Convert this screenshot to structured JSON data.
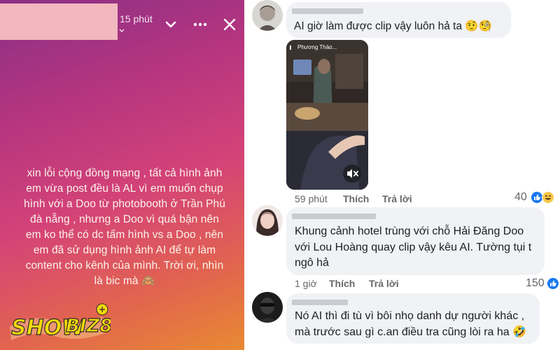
{
  "story": {
    "time": "15 phút",
    "text": "xin lỗi cộng đồng mạng , tất cả hình ảnh em vừa post đều là AL vì em muốn chụp hình với a Doo từ photobooth ở Trần Phú đà nẵng , nhưng a Doo vì quá bận nên em ko thể có dc tấm hình vs a Doo , nên em đã sử dụng hình ảnh AI để tự làm content cho kênh của mình. Trời ơi, nhìn là bic mà 🙈",
    "logo": "SHOWBIZ8",
    "icons": [
      "chevron-down-icon",
      "more-icon",
      "close-icon"
    ]
  },
  "comments": [
    {
      "text": "AI giờ làm được clip vậy luôn hả ta 🤨🧐",
      "video": {
        "overlay_title": "Phương Thảo..."
      },
      "time": "59 phút",
      "like": "Thích",
      "reply": "Trả lời",
      "reactions": "40"
    },
    {
      "text_lines": [
        "Khung cảnh hotel trùng với chỗ Hải Đăng Doo",
        "với Lou Hoàng quay clip vậy kêu AI. Tường tụi t",
        "ngô hả"
      ],
      "time": "1 giờ",
      "like": "Thích",
      "reply": "Trả lời",
      "reactions": "150"
    },
    {
      "text_lines": [
        "Nó AI thì đi tù vì bôi nhọ danh dự người khác ,",
        "mà trước sau gì c.an điều tra cũng lòi ra ha 🤣"
      ]
    }
  ],
  "colors": {
    "like_blue": "#1877f2",
    "haha_yellow": "#f7c84a",
    "bubble": "#f0f2f5",
    "meta": "#65676b"
  }
}
